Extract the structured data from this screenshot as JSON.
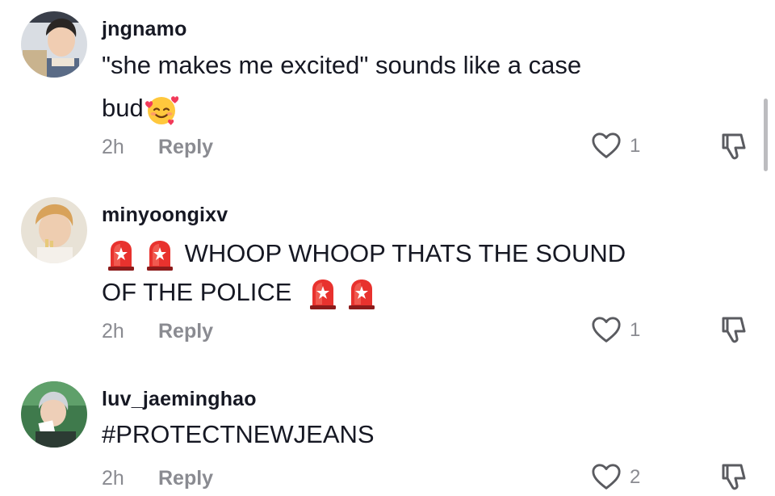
{
  "comments": [
    {
      "username": "jngnamo",
      "line1": "\"she makes me excited\" sounds like a case",
      "line2": "bud",
      "line2_emoji": "smiling-face-with-hearts-icon",
      "time": "2h",
      "reply_label": "Reply",
      "likes": "1"
    },
    {
      "username": "minyoongixv",
      "line1": "WHOOP WHOOP THATS THE SOUND",
      "line1_emojis": [
        "police-light-icon",
        "police-light-icon"
      ],
      "line2": "OF THE POLICE",
      "line2_emojis": [
        "police-light-icon",
        "police-light-icon"
      ],
      "time": "2h",
      "reply_label": "Reply",
      "likes": "1"
    },
    {
      "username": "luv_jaeminghao",
      "line1": "#PROTECTNEWJEANS",
      "time": "2h",
      "reply_label": "Reply",
      "likes": "2"
    }
  ],
  "colors": {
    "text": "#161823",
    "muted": "#8a8b91",
    "scrollbar": "#bcbcbf"
  }
}
